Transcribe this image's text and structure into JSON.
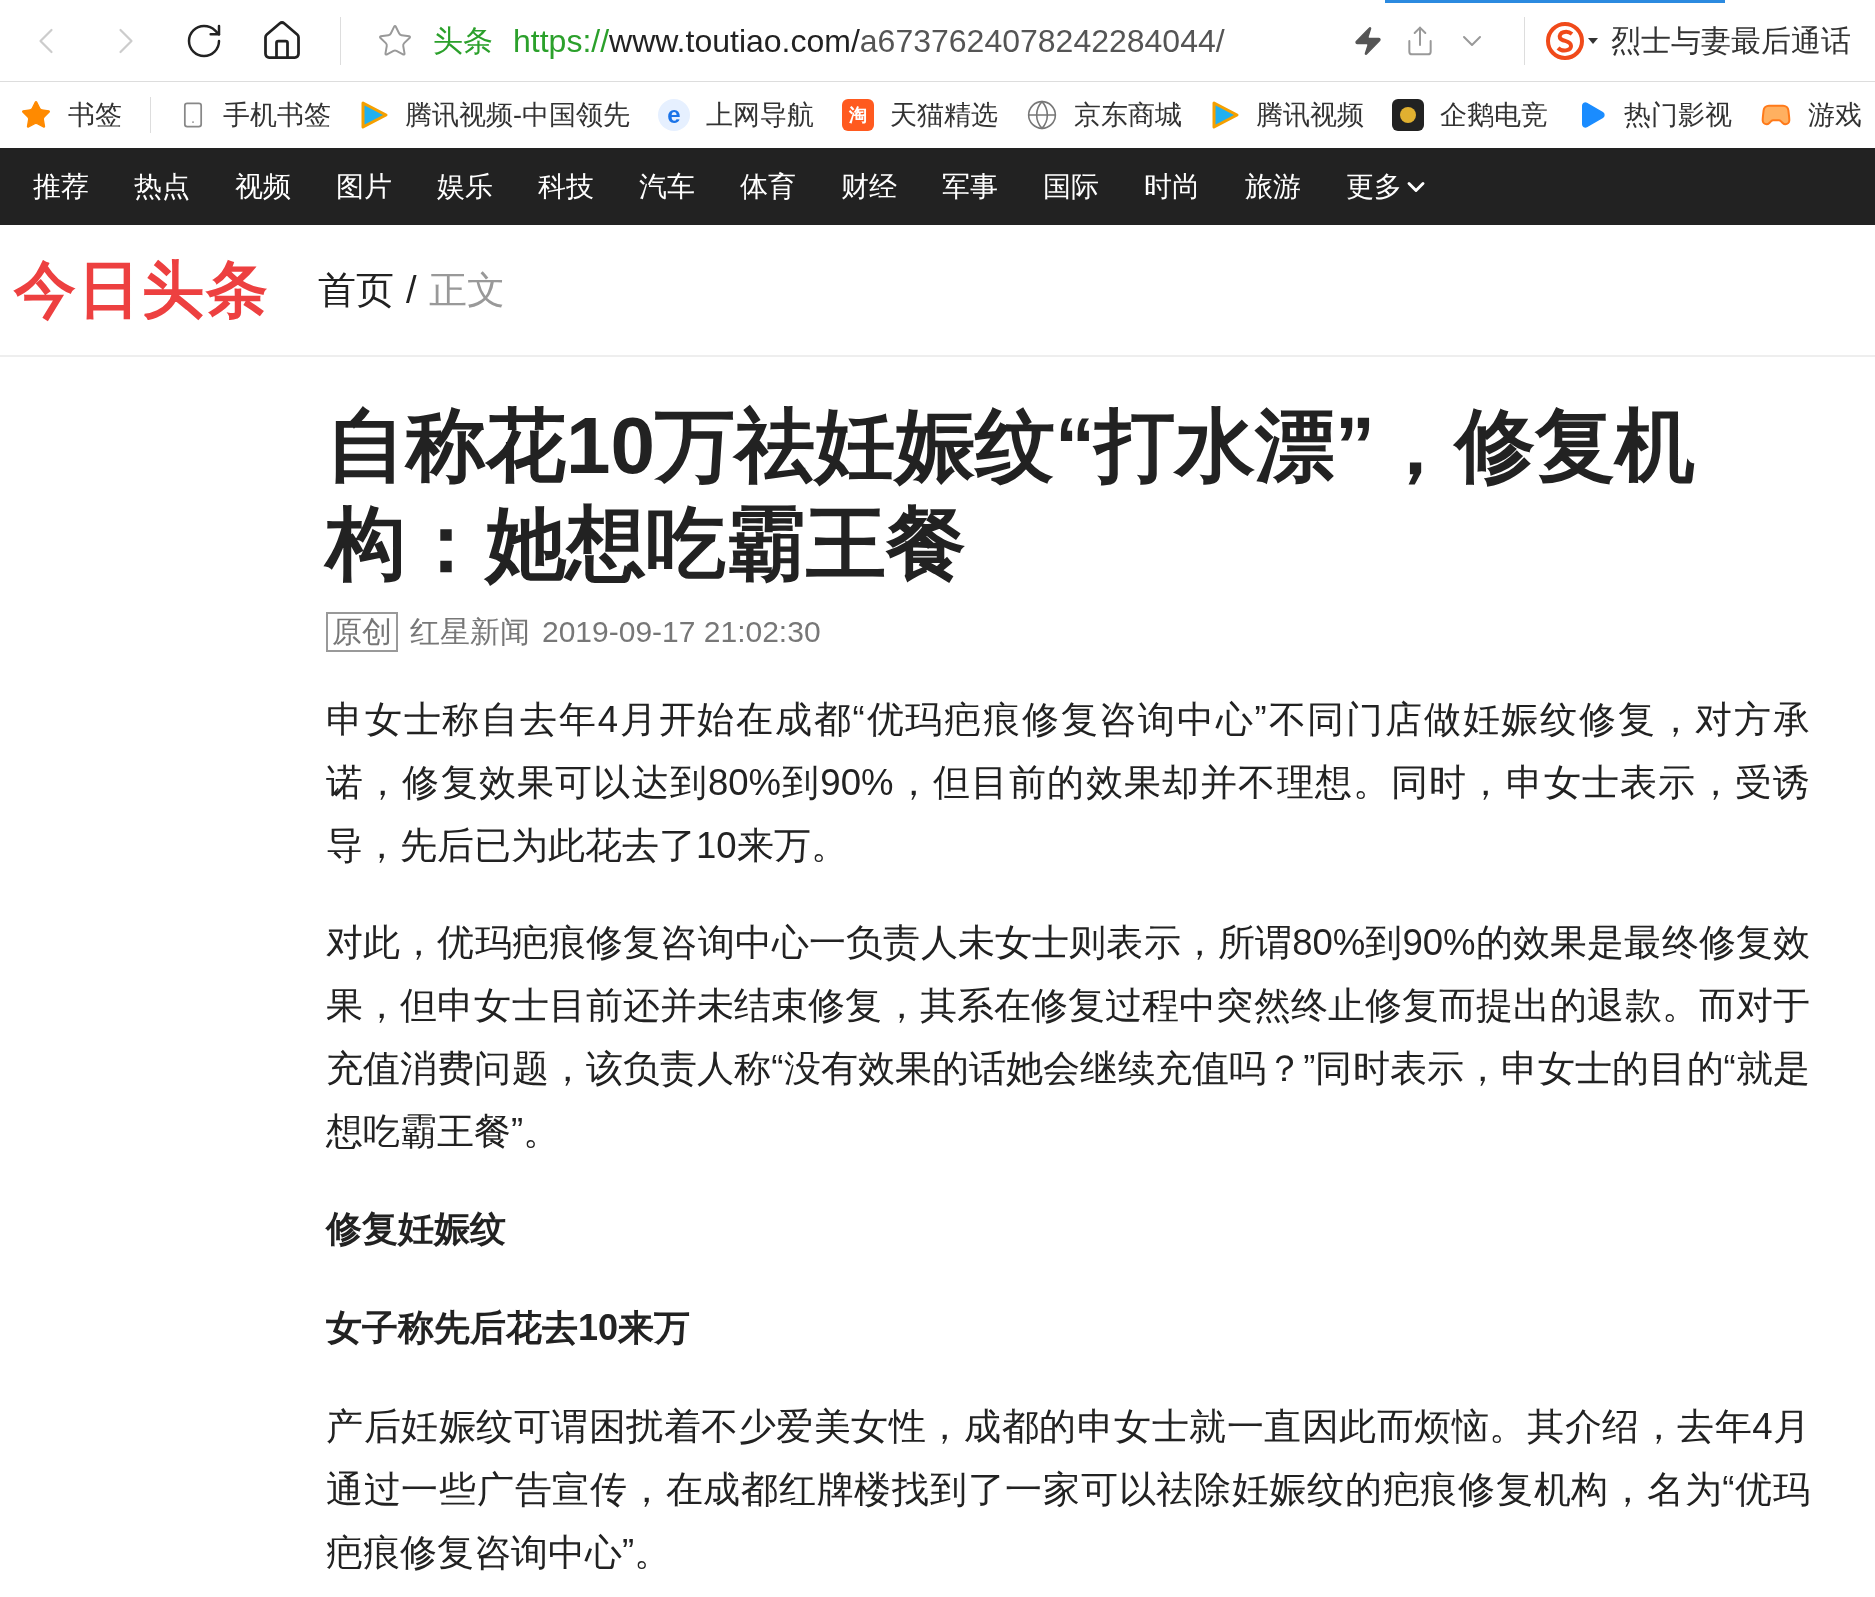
{
  "browser": {
    "tab_label": "头条",
    "url": [
      {
        "text": "https://",
        "kind": "scheme"
      },
      {
        "text": "www.toutiao.com/",
        "kind": "host"
      },
      {
        "text": "a6737624078242284044/",
        "kind": "path"
      }
    ],
    "search_hint": "烈士与妻最后通话"
  },
  "bookmarks": [
    {
      "label": "书签",
      "kind": "star"
    },
    {
      "label": "手机书签",
      "kind": "phone"
    },
    {
      "label": "腾讯视频-中国领先",
      "kind": "video"
    },
    {
      "label": "上网导航",
      "kind": "ie",
      "glyph": "e"
    },
    {
      "label": "天猫精选",
      "kind": "tmall",
      "glyph": "淘"
    },
    {
      "label": "京东商城",
      "kind": "globe"
    },
    {
      "label": "腾讯视频",
      "kind": "video"
    },
    {
      "label": "企鹅电竞",
      "kind": "esports"
    },
    {
      "label": "热门影视",
      "kind": "play"
    },
    {
      "label": "游戏",
      "kind": "game"
    }
  ],
  "nav": {
    "items": [
      "推荐",
      "热点",
      "视频",
      "图片",
      "娱乐",
      "科技",
      "汽车",
      "体育",
      "财经",
      "军事",
      "国际",
      "时尚",
      "旅游"
    ],
    "more": "更多"
  },
  "header": {
    "logo": "今日头条",
    "breadcrumb": [
      {
        "text": "首页",
        "current": false
      },
      {
        "text": "正文",
        "current": true
      }
    ],
    "separator": "/"
  },
  "article": {
    "title": "自称花10万祛妊娠纹“打水漂”，修复机构：她想吃霸王餐",
    "tag": "原创",
    "source": "红星新闻",
    "time": "2019-09-17 21:02:30",
    "blocks": [
      {
        "kind": "p",
        "text": "申女士称自去年4月开始在成都“优玛疤痕修复咨询中心”不同门店做妊娠纹修复，对方承诺，修复效果可以达到80%到90%，但目前的效果却并不理想。同时，申女士表示，受诱导，先后已为此花去了10来万。"
      },
      {
        "kind": "p",
        "text": "对此，优玛疤痕修复咨询中心一负责人未女士则表示，所谓80%到90%的效果是最终修复效果，但申女士目前还并未结束修复，其系在修复过程中突然终止修复而提出的退款。而对于充值消费问题，该负责人称“没有效果的话她会继续充值吗？”同时表示，申女士的目的“就是想吃霸王餐”。"
      },
      {
        "kind": "h",
        "text": "修复妊娠纹"
      },
      {
        "kind": "h",
        "text": "女子称先后花去10来万"
      },
      {
        "kind": "p",
        "text": "产后妊娠纹可谓困扰着不少爱美女性，成都的申女士就一直因此而烦恼。其介绍，去年4月通过一些广告宣传，在成都红牌楼找到了一家可以祛除妊娠纹的疤痕修复机构，名为“优玛疤痕修复咨询中心”。"
      }
    ]
  }
}
